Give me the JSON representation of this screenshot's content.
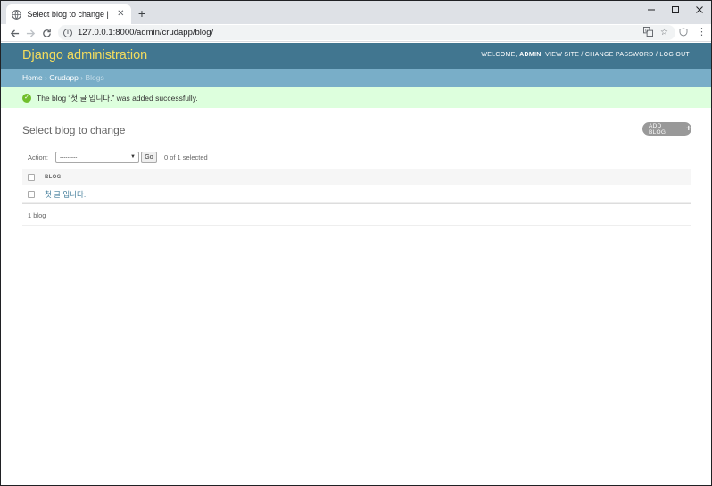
{
  "browser": {
    "tab_title": "Select blog to change | Django",
    "url": "127.0.0.1:8000/admin/crudapp/blog/"
  },
  "header": {
    "branding": "Django administration",
    "welcome": "WELCOME,",
    "username": "ADMIN",
    "view_site": "VIEW SITE",
    "change_password": "CHANGE PASSWORD",
    "log_out": "LOG OUT",
    "separator": "/"
  },
  "breadcrumbs": {
    "home": "Home",
    "app": "Crudapp",
    "model": "Blogs",
    "sep": "›"
  },
  "message": {
    "text": "The blog “첫 글 입니다.” was added successfully."
  },
  "content": {
    "title": "Select blog to change",
    "add_button": "ADD BLOG"
  },
  "actions": {
    "label": "Action:",
    "selected_value": "---------",
    "go_label": "Go",
    "counter": "0 of 1 selected"
  },
  "table": {
    "column_header": "BLOG",
    "rows": [
      "첫 글 입니다."
    ]
  },
  "paginator": {
    "text": "1 blog"
  },
  "colors": {
    "header_bg": "#417690",
    "branding": "#f5dd5d",
    "breadcrumbs_bg": "#79aec8",
    "success_bg": "#dfd",
    "link": "#447e9b"
  },
  "icons": {
    "tab_favicon": "globe-icon",
    "success": "check-circle-icon",
    "add": "plus-icon"
  }
}
